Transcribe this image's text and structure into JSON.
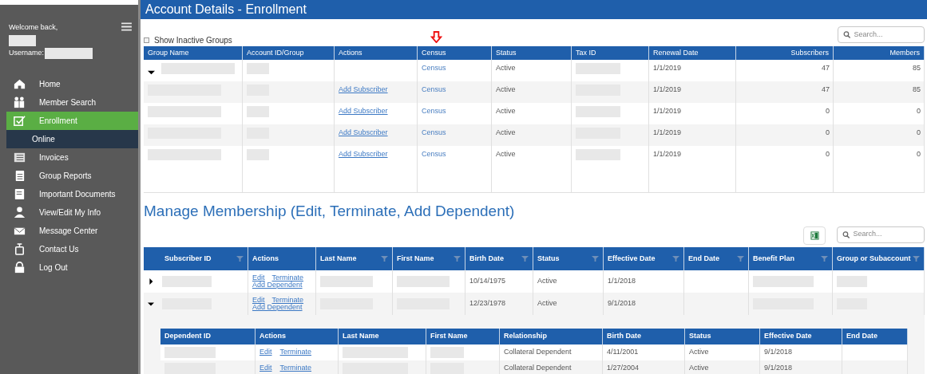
{
  "sidebar": {
    "welcome": "Welcome back,",
    "username_label": "Username:",
    "items": [
      {
        "label": "Home",
        "selected": false
      },
      {
        "label": "Member Search",
        "selected": false
      },
      {
        "label": "Enrollment",
        "selected": true,
        "children": [
          {
            "label": "Online",
            "selected": true
          }
        ]
      },
      {
        "label": "Invoices",
        "selected": false
      },
      {
        "label": "Group Reports",
        "selected": false
      },
      {
        "label": "Important Documents",
        "selected": false
      },
      {
        "label": "View/Edit My Info",
        "selected": false
      },
      {
        "label": "Message Center",
        "selected": false
      },
      {
        "label": "Contact Us",
        "selected": false
      },
      {
        "label": "Log Out",
        "selected": false
      }
    ]
  },
  "page_title": "Account Details - Enrollment",
  "groups": {
    "show_inactive": {
      "label": "Show Inactive Groups",
      "checked": false
    },
    "search": {
      "placeholder": "Search..."
    },
    "columns": [
      {
        "label": "Group Name",
        "kind": "redacted"
      },
      {
        "label": "Account ID/Group",
        "kind": "redacted"
      },
      {
        "label": "Actions",
        "kind": "links"
      },
      {
        "label": "Census",
        "kind": "link"
      },
      {
        "label": "Status",
        "kind": "text"
      },
      {
        "label": "Tax ID",
        "kind": "redacted"
      },
      {
        "label": "Renewal Date",
        "kind": "text"
      },
      {
        "label": "Subscribers",
        "kind": "number"
      },
      {
        "label": "Members",
        "kind": "number"
      }
    ],
    "rows": [
      {
        "kind": "group",
        "expanded": true,
        "cells": [
          "",
          "",
          "",
          "Census",
          "Active",
          "",
          "1/1/2019",
          "47",
          "85"
        ]
      },
      {
        "kind": "subgroup",
        "cells": [
          "",
          "",
          [
            "Add Subscriber"
          ],
          "Census",
          "Active",
          "",
          "1/1/2019",
          "47",
          "85"
        ]
      },
      {
        "kind": "subgroup",
        "cells": [
          "",
          "",
          [
            "Add Subscriber"
          ],
          "Census",
          "Active",
          "",
          "1/1/2019",
          "0",
          "0"
        ]
      },
      {
        "kind": "subgroup",
        "cells": [
          "",
          "",
          [
            "Add Subscriber"
          ],
          "Census",
          "Active",
          "",
          "1/1/2019",
          "0",
          "0"
        ]
      },
      {
        "kind": "subgroup",
        "cells": [
          "",
          "",
          [
            "Add Subscriber"
          ],
          "Census",
          "Active",
          "",
          "1/1/2019",
          "0",
          "0"
        ]
      }
    ]
  },
  "membership": {
    "title": "Manage Membership (Edit, Terminate, Add Dependent)",
    "search": {
      "placeholder": "Search..."
    },
    "columns": [
      {
        "label": "Subscriber ID",
        "kind": "redacted",
        "filter": true
      },
      {
        "label": "Actions",
        "kind": "links",
        "filter": false
      },
      {
        "label": "Last Name",
        "kind": "redacted",
        "filter": true
      },
      {
        "label": "First Name",
        "kind": "redacted",
        "filter": true
      },
      {
        "label": "Birth Date",
        "kind": "text",
        "filter": true
      },
      {
        "label": "Status",
        "kind": "text",
        "filter": true
      },
      {
        "label": "Effective Date",
        "kind": "text",
        "filter": true
      },
      {
        "label": "End Date",
        "kind": "text",
        "filter": true
      },
      {
        "label": "Benefit Plan",
        "kind": "redacted",
        "filter": true
      },
      {
        "label": "Group or Subaccount",
        "kind": "redacted",
        "filter": true
      }
    ],
    "rows": [
      {
        "expanded": false,
        "cells": [
          "",
          [
            "Edit",
            "Terminate",
            "Add Dependent"
          ],
          "",
          "",
          "10/14/1975",
          "Active",
          "1/1/2018",
          "",
          "",
          ""
        ]
      },
      {
        "expanded": true,
        "cells": [
          "",
          [
            "Edit",
            "Terminate",
            "Add Dependent"
          ],
          "",
          "",
          "12/23/1978",
          "Active",
          "9/1/2018",
          "",
          "",
          ""
        ]
      }
    ],
    "dependents": {
      "columns": [
        {
          "label": "Dependent ID",
          "kind": "redacted"
        },
        {
          "label": "Actions",
          "kind": "links"
        },
        {
          "label": "Last Name",
          "kind": "redacted"
        },
        {
          "label": "First Name",
          "kind": "redacted"
        },
        {
          "label": "Relationship",
          "kind": "text"
        },
        {
          "label": "Birth Date",
          "kind": "text"
        },
        {
          "label": "Status",
          "kind": "text"
        },
        {
          "label": "Effective Date",
          "kind": "text"
        },
        {
          "label": "End Date",
          "kind": "text"
        }
      ],
      "rows": [
        {
          "cells": [
            "",
            [
              "Edit",
              "Terminate"
            ],
            "",
            "",
            "Collateral Dependent",
            "4/11/2001",
            "Active",
            "9/1/2018",
            ""
          ]
        },
        {
          "cells": [
            "",
            [
              "Edit",
              "Terminate"
            ],
            "",
            "",
            "Collateral Dependent",
            "1/27/2004",
            "Active",
            "9/1/2018",
            ""
          ]
        }
      ]
    }
  }
}
